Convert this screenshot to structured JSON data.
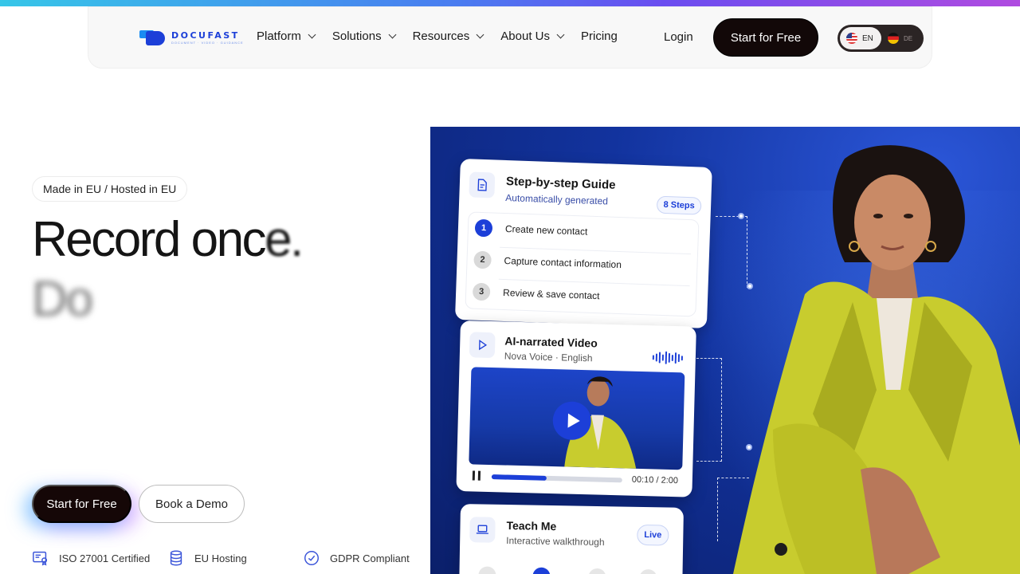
{
  "brand": {
    "name": "DOCUFAST",
    "tagline": "DOCUMENT · VIDEO · GUIDANCE",
    "accent": "#1c3fd8",
    "dark": "#150707"
  },
  "nav": {
    "items": [
      {
        "label": "Platform",
        "dropdown": true
      },
      {
        "label": "Solutions",
        "dropdown": true
      },
      {
        "label": "Resources",
        "dropdown": true
      },
      {
        "label": "About Us",
        "dropdown": true
      },
      {
        "label": "Pricing",
        "dropdown": false
      }
    ],
    "login": "Login",
    "cta": "Start for Free",
    "languages": [
      {
        "code": "EN",
        "active": true
      },
      {
        "code": "DE",
        "active": false
      }
    ]
  },
  "hero": {
    "badge": "Made in EU / Hosted in EU",
    "headline_line1": "Record once.",
    "headline_line2": "Do",
    "primary_cta": "Start for Free",
    "secondary_cta": "Book a Demo",
    "trust": [
      {
        "icon": "certificate-icon",
        "label": "ISO 27001 Certified"
      },
      {
        "icon": "database-icon",
        "label": "EU Hosting"
      },
      {
        "icon": "check-badge-icon",
        "label": "GDPR Compliant"
      }
    ]
  },
  "guide_card": {
    "title": "Step-by-step Guide",
    "subtitle": "Automatically generated",
    "steps_badge": "8 Steps",
    "steps": [
      {
        "num": "1",
        "label": "Create new contact",
        "active": true
      },
      {
        "num": "2",
        "label": "Capture contact information",
        "active": false
      },
      {
        "num": "3",
        "label": "Review & save contact",
        "active": false
      }
    ]
  },
  "video_card": {
    "title": "AI-narrated Video",
    "subtitle": "Nova Voice · English",
    "time": "00:10 / 2:00",
    "progress": 0.42
  },
  "teach_card": {
    "title": "Teach Me",
    "subtitle": "Interactive walkthrough",
    "badge": "Live"
  }
}
